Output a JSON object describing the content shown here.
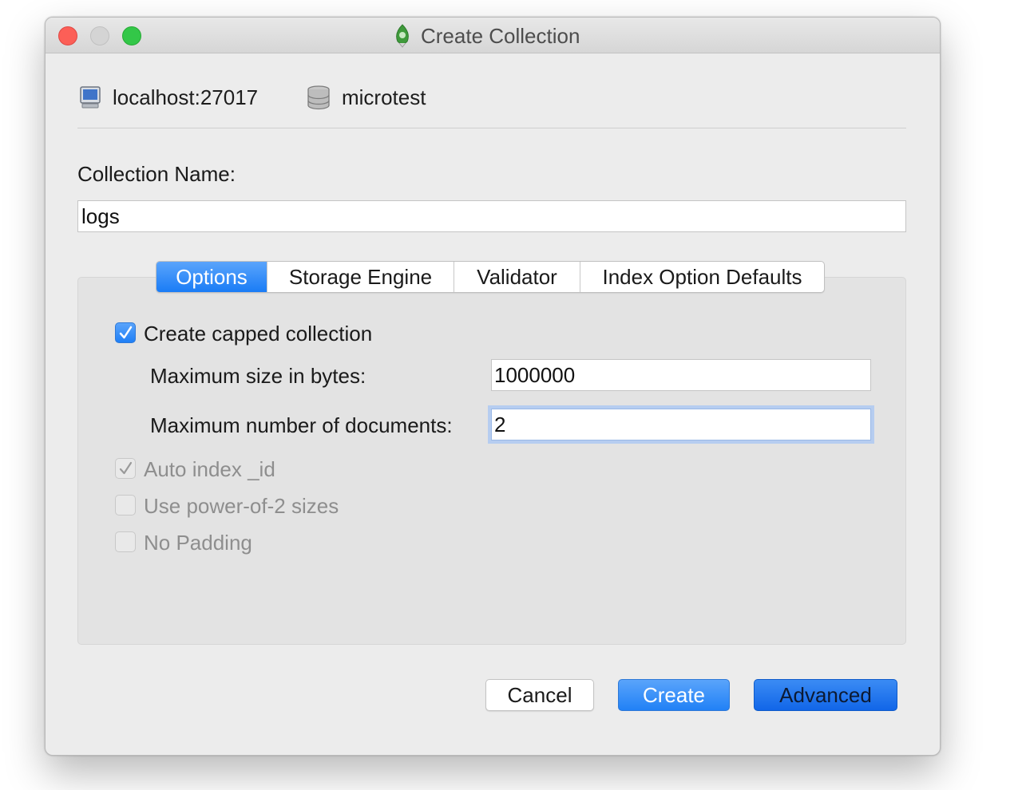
{
  "window": {
    "title": "Create Collection"
  },
  "connection": {
    "server": "localhost:27017",
    "database": "microtest"
  },
  "form": {
    "name_label": "Collection Name:",
    "name_value": "logs"
  },
  "tabs": [
    {
      "label": "Options",
      "active": true
    },
    {
      "label": "Storage Engine",
      "active": false
    },
    {
      "label": "Validator",
      "active": false
    },
    {
      "label": "Index Option Defaults",
      "active": false
    }
  ],
  "options": {
    "capped": {
      "label": "Create capped collection",
      "checked": true
    },
    "max_size": {
      "label": "Maximum size in bytes:",
      "value": "1000000"
    },
    "max_docs": {
      "label": "Maximum number of documents:",
      "value": "2"
    },
    "auto_index": {
      "label": "Auto index _id",
      "checked": true,
      "enabled": false
    },
    "power_of_2": {
      "label": "Use power-of-2 sizes",
      "checked": false,
      "enabled": false
    },
    "no_padding": {
      "label": "No Padding",
      "checked": false,
      "enabled": false
    }
  },
  "buttons": {
    "cancel": "Cancel",
    "create": "Create",
    "advanced": "Advanced"
  },
  "colors": {
    "accent": "#1a7cf6",
    "close": "#fc5f57",
    "maximize": "#33c748",
    "minimize": "#d4d4d4"
  },
  "icons": {
    "title": "leaf-logo-icon",
    "server": "monitor-icon",
    "database": "database-icon"
  }
}
